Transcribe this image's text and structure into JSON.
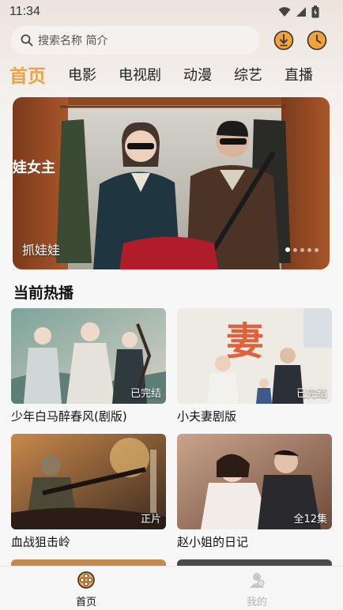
{
  "status_bar": {
    "time": "11:34"
  },
  "search": {
    "placeholder": "搜索名称 简介"
  },
  "tabs": [
    "首页",
    "电影",
    "电视剧",
    "动漫",
    "综艺",
    "直播"
  ],
  "banner": {
    "caption": "抓娃娃",
    "side_text": "娃女主",
    "slide_count": 5,
    "active_slide": 1
  },
  "section": {
    "title": "当前热播"
  },
  "cards": [
    {
      "title": "少年白马醉春风(剧版)",
      "badge": "已完结"
    },
    {
      "title": "小夫妻剧版",
      "badge": "已完结",
      "poster_text": "妻"
    },
    {
      "title": "血战狙击岭",
      "badge": "正片"
    },
    {
      "title": "赵小姐的日记",
      "badge": "全12集"
    }
  ],
  "bottom_nav": [
    {
      "label": "首页",
      "icon": "home-film-reel-icon",
      "active": true
    },
    {
      "label": "我的",
      "icon": "profile-icon",
      "active": false
    }
  ],
  "colors": {
    "accent": "#f0a23c",
    "inactive_nav": "#b5b5b5"
  }
}
